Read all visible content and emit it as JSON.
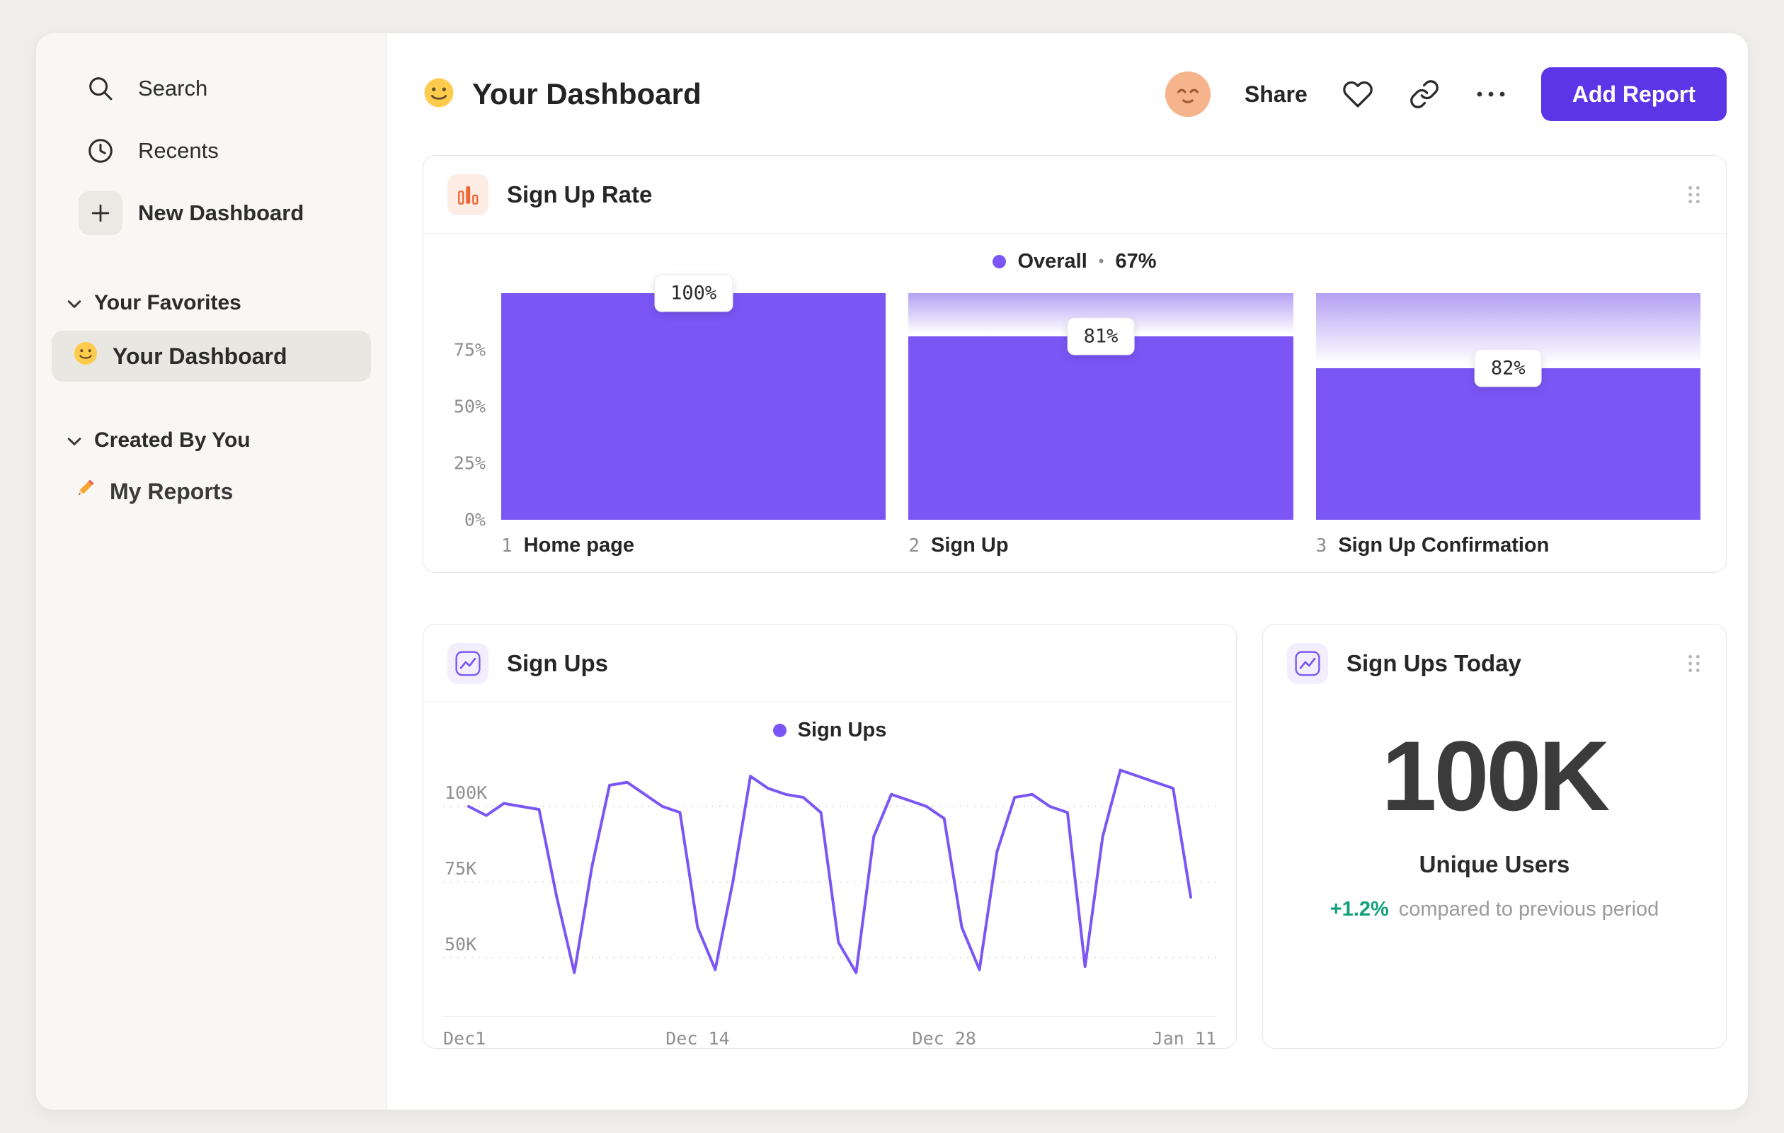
{
  "app": {
    "header": {
      "emoji": "🙂",
      "title": "Your Dashboard",
      "avatar_emoji": "😌",
      "share_label": "Share",
      "add_report_label": "Add Report"
    },
    "sidebar": {
      "search_label": "Search",
      "recents_label": "Recents",
      "new_dashboard_label": "New Dashboard",
      "favorites_title": "Your Favorites",
      "favorite_item": {
        "emoji": "🙂",
        "label": "Your Dashboard"
      },
      "created_title": "Created By You",
      "created_item": {
        "emoji": "✏️",
        "label": "My Reports"
      }
    }
  },
  "funnel_card": {
    "title": "Sign Up Rate",
    "legend_label": "Overall",
    "legend_sep": "•",
    "legend_value": "67%"
  },
  "line_card": {
    "title": "Sign Ups",
    "legend_label": "Sign Ups"
  },
  "stat_card": {
    "title": "Sign Ups Today",
    "value": "100K",
    "label": "Unique Users",
    "delta": "+1.2%",
    "delta_note": "compared to previous period"
  },
  "colors": {
    "accent_purple": "#7B56F5",
    "button_purple": "#5B35E6",
    "icon_orange": "#EF6536",
    "delta_green": "#12A07B"
  },
  "icons": {
    "sidebar": [
      "search-icon",
      "clock-icon",
      "plus-icon",
      "chevron-down-icon",
      "smiley-emoji-icon",
      "pencil-emoji-icon"
    ],
    "header": [
      "avatar",
      "heart-icon",
      "link-icon",
      "ellipsis-icon"
    ],
    "cards": [
      "bar-chart-icon",
      "line-chart-icon",
      "drag-handle-icon"
    ]
  },
  "chart_data": [
    {
      "type": "bar",
      "title": "Sign Up Rate",
      "legend": "Overall • 67%",
      "bar_color": "#7B56F5",
      "y_ticks": [
        "75%",
        "50%",
        "25%",
        "0%"
      ],
      "ylim": [
        0,
        100
      ],
      "steps": [
        {
          "index": "1",
          "label": "Home page",
          "value_label": "100%",
          "bar_height_pct": 100
        },
        {
          "index": "2",
          "label": "Sign Up",
          "value_label": "81%",
          "bar_height_pct": 81
        },
        {
          "index": "3",
          "label": "Sign Up Confirmation",
          "value_label": "82%",
          "bar_height_pct": 67
        }
      ]
    },
    {
      "type": "line",
      "title": "Sign Ups",
      "legend": "Sign Ups",
      "color": "#7B56F5",
      "unit": "K",
      "y_ticks": [
        {
          "label": "100K",
          "value": 100
        },
        {
          "label": "75K",
          "value": 75
        },
        {
          "label": "50K",
          "value": 50
        }
      ],
      "x_tick_labels": [
        {
          "label": "Dec1",
          "day": 0
        },
        {
          "label": "Dec 14",
          "day": 13
        },
        {
          "label": "Dec 28",
          "day": 27
        },
        {
          "label": "Jan 11",
          "day": 41
        }
      ],
      "values": [
        100,
        97,
        101,
        100,
        99,
        70,
        45,
        80,
        107,
        108,
        104,
        100,
        98,
        60,
        46,
        75,
        110,
        106,
        104,
        103,
        98,
        55,
        45,
        90,
        104,
        102,
        100,
        96,
        60,
        46,
        85,
        103,
        104,
        100,
        98,
        47,
        90,
        112,
        110,
        108,
        106,
        70
      ]
    }
  ]
}
